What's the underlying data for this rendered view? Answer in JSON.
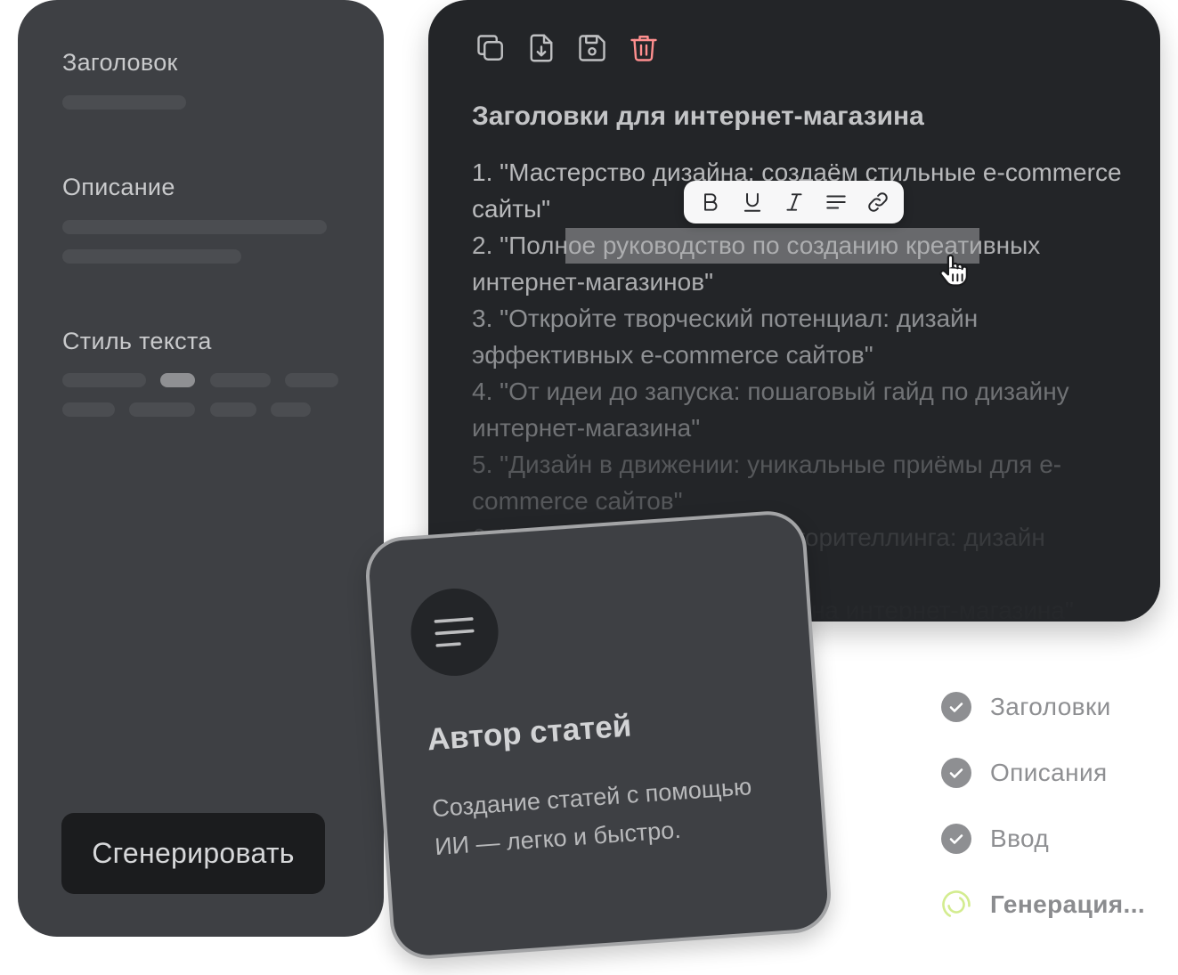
{
  "form": {
    "title_label": "Заголовок",
    "description_label": "Описание",
    "style_label": "Стиль текста",
    "generate_button": "Сгенерировать"
  },
  "editor": {
    "toolbar": [
      "copy-icon",
      "download-icon",
      "save-icon",
      "trash-icon"
    ],
    "delete_color": "#ff8f8f",
    "title": "Заголовки для интернет-магазина",
    "items": [
      "1. \"Мастерство дизайна: создаём стильные e-commerce сайты\"",
      "2. \"Полное руководство по созданию креативных интернет-магазинов\"",
      "3. \"Откройте творческий потенциал: дизайн эффективных e-commerce сайтов\"",
      "4. \"От идеи до запуска: пошаговый гайд по дизайну интернет-магазина\"",
      "5. \"Дизайн в движении: уникальные приёмы для e-commerce сайтов\"",
      "6. \"Искусство визуального сторителлинга: дизайн интернет-магазина\"",
      "7. \"Секреты успешного дизайна интернет-магазина\""
    ],
    "format_toolbar": [
      "bold-icon",
      "underline-icon",
      "italic-icon",
      "align-icon",
      "link-icon"
    ]
  },
  "card": {
    "icon": "menu-lines-icon",
    "title": "Автор статей",
    "description": "Создание статей с помощью ИИ — легко и быстро."
  },
  "status": {
    "accent": "#d3ec8f",
    "steps": [
      {
        "label": "Заголовки",
        "state": "done"
      },
      {
        "label": "Описания",
        "state": "done"
      },
      {
        "label": "Ввод",
        "state": "done"
      },
      {
        "label": "Генерация...",
        "state": "in-progress"
      }
    ]
  }
}
